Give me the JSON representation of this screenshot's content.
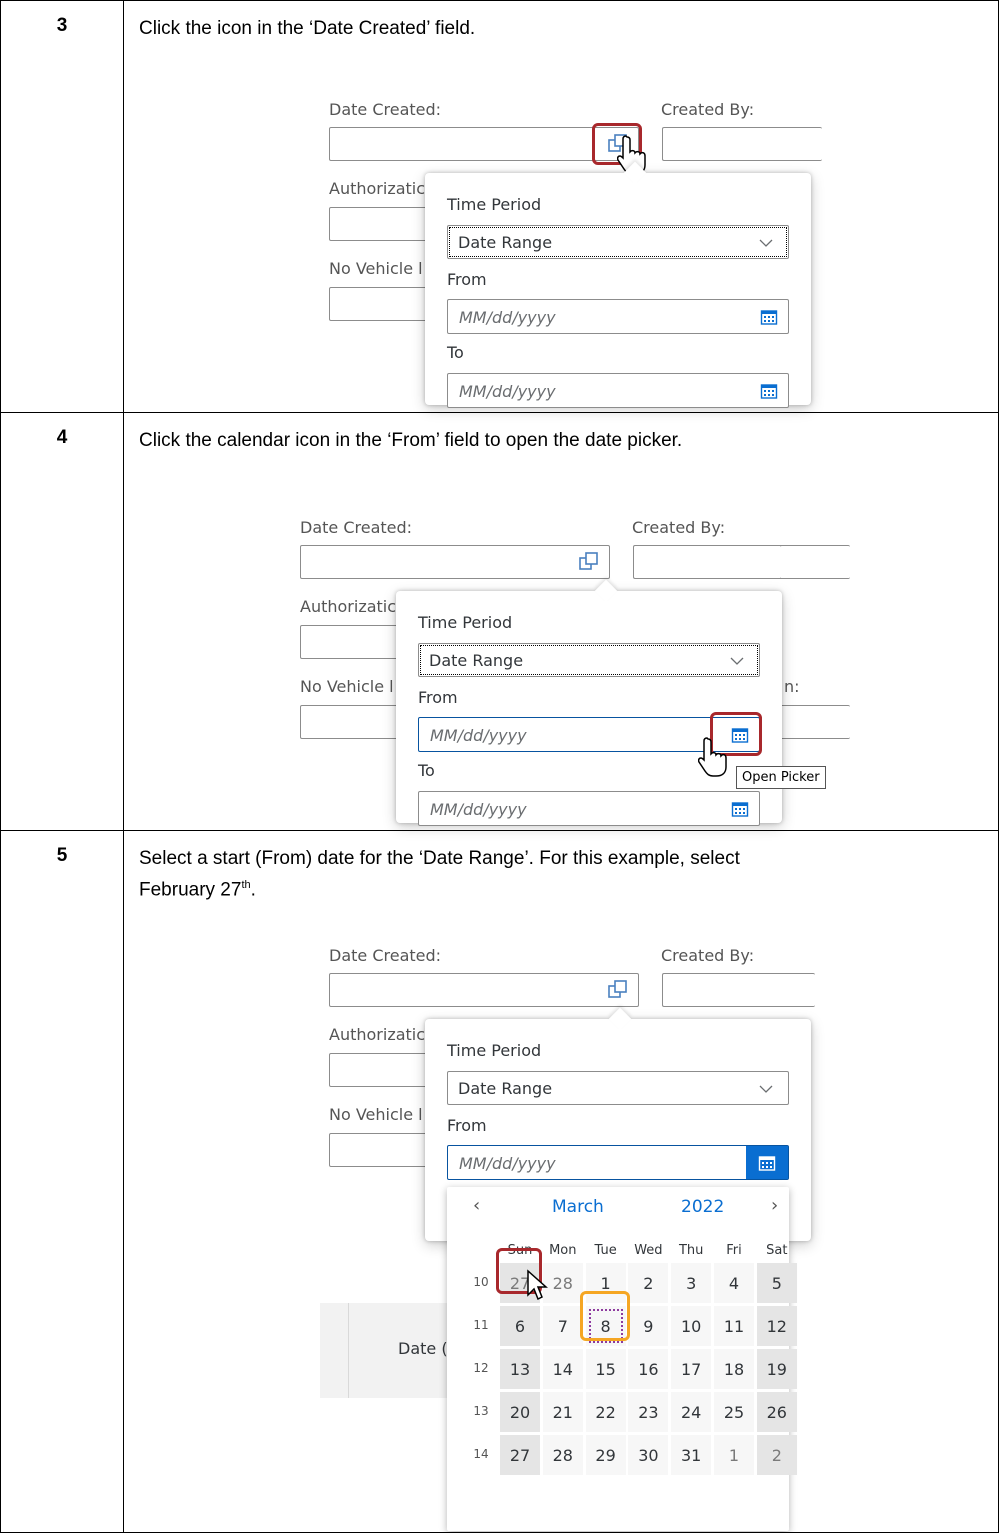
{
  "steps": [
    {
      "number": "3",
      "instruction": "Click the icon in the ‘Date Created’ field.",
      "screenshot": {
        "date_created_label": "Date Created:",
        "created_by_label": "Created By:",
        "authorization_label": "Authorizatic",
        "no_vehicle_label": "No Vehicle l",
        "time_period_label": "Time Period",
        "time_period_value": "Date Range",
        "from_label": "From",
        "from_placeholder": "MM/dd/yyyy",
        "to_label": "To",
        "to_placeholder": "MM/dd/yyyy"
      }
    },
    {
      "number": "4",
      "instruction": "Click the calendar icon in the ‘From’ field to open the date picker.",
      "screenshot": {
        "date_created_label": "Date Created:",
        "created_by_label": "Created By:",
        "authorization_label": "Authorizatic",
        "no_vehicle_label": "No Vehicle l",
        "right_fragment": "n:",
        "time_period_label": "Time Period",
        "time_period_value": "Date Range",
        "from_label": "From",
        "from_placeholder": "MM/dd/yyyy",
        "to_label": "To",
        "to_placeholder": "MM/dd/yyyy",
        "tooltip": "Open Picker"
      }
    },
    {
      "number": "5",
      "instruction_line1": "Select a start (From) date for the ‘Date Range’. For this example, select",
      "instruction_line2": "February 27",
      "instruction_sup": "th",
      "instruction_end": ".",
      "screenshot": {
        "date_created_label": "Date Created:",
        "created_by_label": "Created By:",
        "authorization_label": "Authorizatic",
        "no_vehicle_label": "No Vehicle l",
        "time_period_label": "Time Period",
        "time_period_value": "Date Range",
        "from_label": "From",
        "from_placeholder": "MM/dd/yyyy",
        "table_header_fragment": "Date (",
        "calendar": {
          "month": "March",
          "year": "2022",
          "weekdays": [
            "Sun",
            "Mon",
            "Tue",
            "Wed",
            "Thu",
            "Fri",
            "Sat"
          ],
          "weeks": [
            {
              "week": "10",
              "days": [
                "27",
                "28",
                "1",
                "2",
                "3",
                "4",
                "5"
              ]
            },
            {
              "week": "11",
              "days": [
                "6",
                "7",
                "8",
                "9",
                "10",
                "11",
                "12"
              ]
            },
            {
              "week": "12",
              "days": [
                "13",
                "14",
                "15",
                "16",
                "17",
                "18",
                "19"
              ]
            },
            {
              "week": "13",
              "days": [
                "20",
                "21",
                "22",
                "23",
                "24",
                "25",
                "26"
              ]
            },
            {
              "week": "14",
              "days": [
                "27",
                "28",
                "29",
                "30",
                "31",
                "1",
                "2"
              ]
            }
          ]
        }
      }
    }
  ]
}
